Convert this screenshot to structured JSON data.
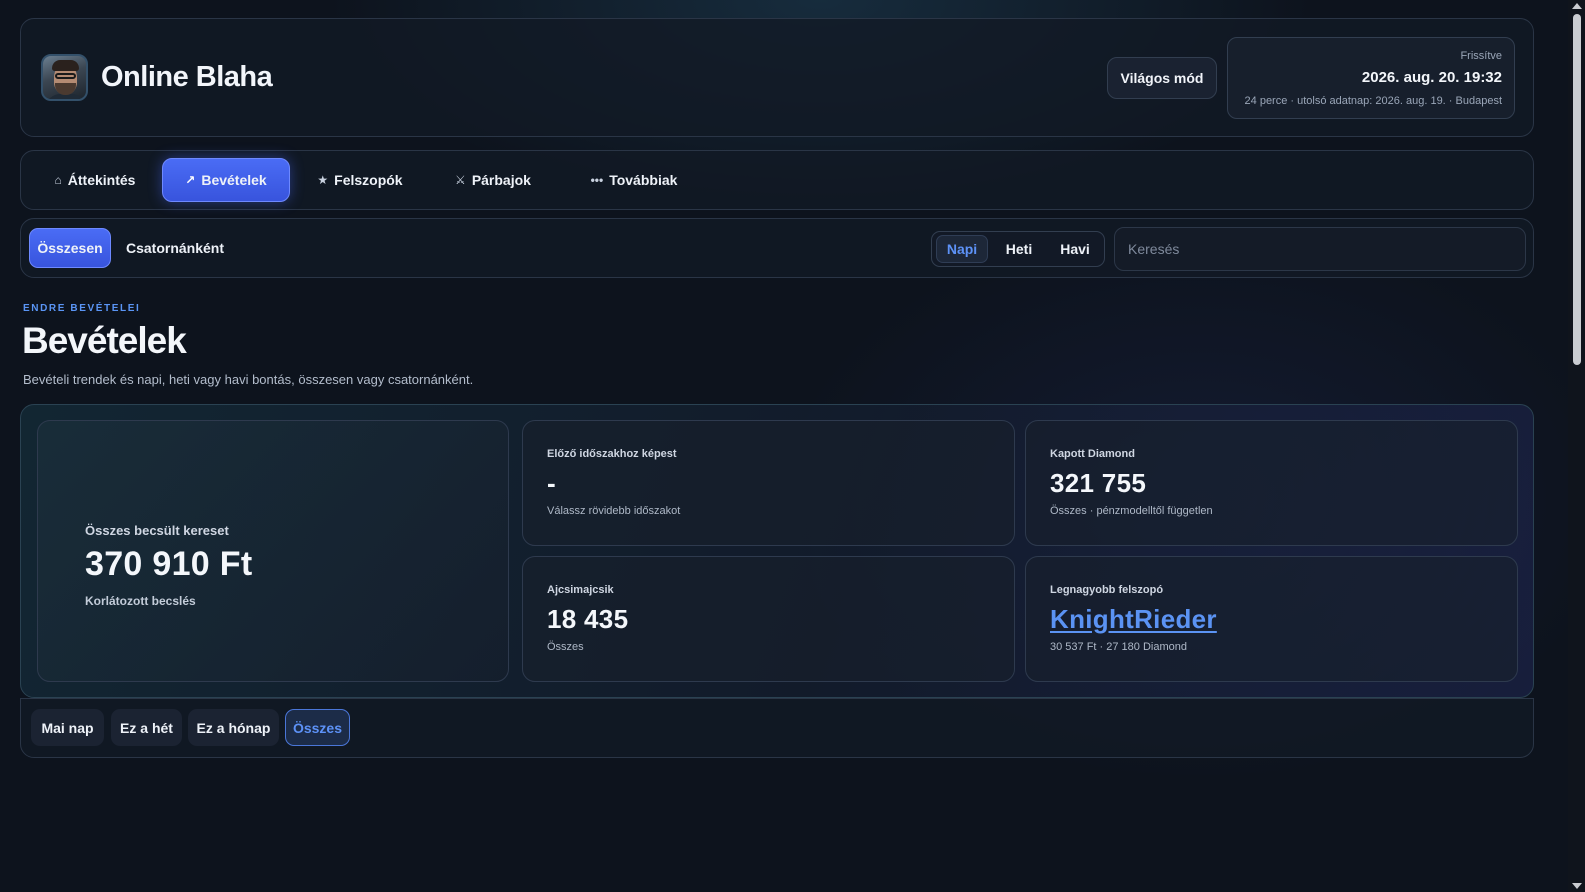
{
  "header": {
    "title": "Online Blaha",
    "theme_button": "Világos mód",
    "refresh_label": "Frissítve",
    "refresh_time": "2026. aug. 20. 19:32",
    "refresh_sub": "24 perce · utolsó adatnap: 2026. aug. 19. · Budapest"
  },
  "nav": {
    "items": [
      {
        "icon": "⌂",
        "label": "Áttekintés"
      },
      {
        "icon": "↗",
        "label": "Bevételek"
      },
      {
        "icon": "★",
        "label": "Felszopók"
      },
      {
        "icon": "⚔",
        "label": "Párbajok"
      },
      {
        "icon": "•••",
        "label": "Továbbiak"
      }
    ],
    "active": "Bevételek"
  },
  "filters": {
    "mode": [
      "Összesen",
      "Csatornánként"
    ],
    "mode_active": "Összesen",
    "periods": [
      "Napi",
      "Heti",
      "Havi"
    ],
    "period_active": "Napi",
    "search_placeholder": "Keresés"
  },
  "page": {
    "eyebrow": "ENDRE BEVÉTELEI",
    "title": "Bevételek",
    "description": "Bevételi trendek és napi, heti vagy havi bontás, összesen vagy csatornánként."
  },
  "stats": {
    "total": {
      "label": "Összes becsült kereset",
      "value": "370 910 Ft",
      "sub": "Korlátozott becslés"
    },
    "compare": {
      "label": "Előző időszakhoz képest",
      "value": "-",
      "sub": "Válassz rövidebb időszakot"
    },
    "diamond": {
      "label": "Kapott Diamond",
      "value": "321 755",
      "sub": "Összes · pénzmodelltől független"
    },
    "ajcsi": {
      "label": "Ajcsimajcsik",
      "value": "18 435",
      "sub": "Összes"
    },
    "top": {
      "label": "Legnagyobb felszopó",
      "value": "KnightRieder",
      "sub": "30 537 Ft · 27 180 Diamond"
    }
  },
  "ranges": {
    "items": [
      "Mai nap",
      "Ez a hét",
      "Ez a hónap",
      "Összes"
    ],
    "active": "Összes"
  },
  "colors": {
    "accent": "#4a6cf5",
    "link": "#5b93f3",
    "background": "#0d131d"
  }
}
